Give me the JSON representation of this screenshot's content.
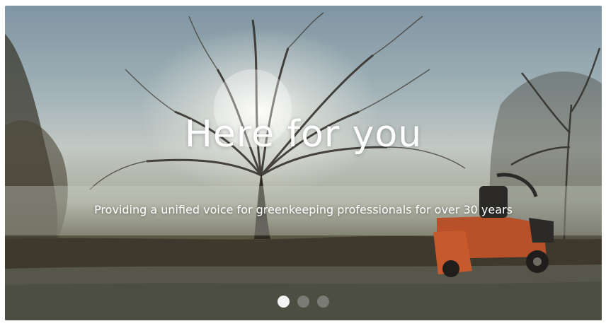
{
  "hero": {
    "headline": "Here for you",
    "subheadline": "Providing a unified voice for greenkeeping professionals for over 30 years",
    "background_image": "park-tree-with-mower-image",
    "accent_color": "#ffffff"
  },
  "carousel": {
    "slide_count": 3,
    "active_index": 0,
    "dots": [
      {
        "label": "Slide 1",
        "active": true
      },
      {
        "label": "Slide 2",
        "active": false
      },
      {
        "label": "Slide 3",
        "active": false
      }
    ]
  }
}
